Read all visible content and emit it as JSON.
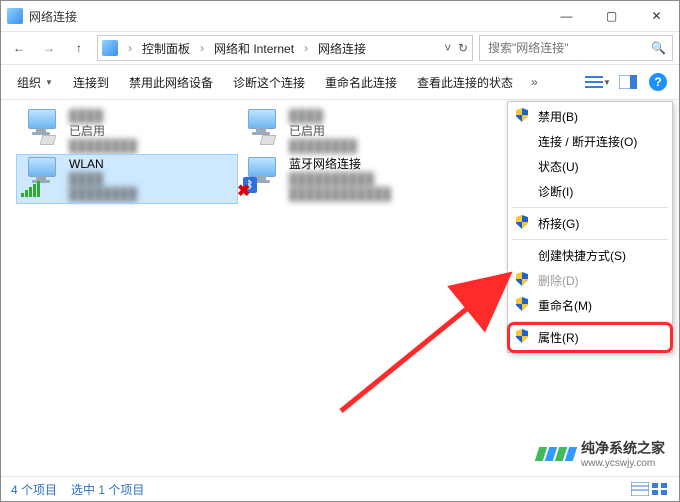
{
  "window": {
    "title": "网络连接"
  },
  "titlebar_icons": {
    "min": "—",
    "max": "▢",
    "close": "✕"
  },
  "nav": {
    "back": "←",
    "fwd": "→",
    "up": "↑"
  },
  "breadcrumb": {
    "root_icon": "control-panel-icon",
    "parts": [
      "控制面板",
      "网络和 Internet",
      "网络连接"
    ]
  },
  "search": {
    "placeholder": "搜索\"网络连接\"",
    "icon": "search"
  },
  "toolbar": {
    "organize": "组织",
    "connect": "连接到",
    "disable": "禁用此网络设备",
    "diagnose": "诊断这个连接",
    "rename": "重命名此连接",
    "view_status": "查看此连接的状态",
    "overflow": "»"
  },
  "connections": [
    {
      "id": "eth1",
      "name": "████",
      "status": "已启用",
      "desc": "",
      "icon": "ethernet",
      "blur_name": true
    },
    {
      "id": "eth2",
      "name": "████",
      "status": "已启用",
      "desc": "",
      "icon": "ethernet",
      "blur_name": true
    },
    {
      "id": "wlan",
      "name": "WLAN",
      "status": "",
      "desc": "",
      "icon": "wifi",
      "selected": true
    },
    {
      "id": "bt",
      "name": "蓝牙网络连接",
      "status": "██████████",
      "desc": "████████████",
      "icon": "bluetooth",
      "blur_status": true,
      "disabled": true
    }
  ],
  "context_menu": [
    {
      "label": "禁用(B)",
      "shield": true
    },
    {
      "label": "连接 / 断开连接(O)"
    },
    {
      "label": "状态(U)"
    },
    {
      "label": "诊断(I)"
    },
    {
      "sep": true
    },
    {
      "label": "桥接(G)",
      "shield": true
    },
    {
      "sep": true
    },
    {
      "label": "创建快捷方式(S)"
    },
    {
      "label": "删除(D)",
      "shield": true,
      "disabled": true
    },
    {
      "label": "重命名(M)",
      "shield": true
    },
    {
      "sep": true
    },
    {
      "label": "属性(R)",
      "shield": true,
      "highlight": true
    }
  ],
  "statusbar": {
    "count": "4 个项目",
    "selected": "选中 1 个项目"
  },
  "watermark": {
    "text": "纯净系统之家",
    "sub": "www.ycswjy.com"
  }
}
